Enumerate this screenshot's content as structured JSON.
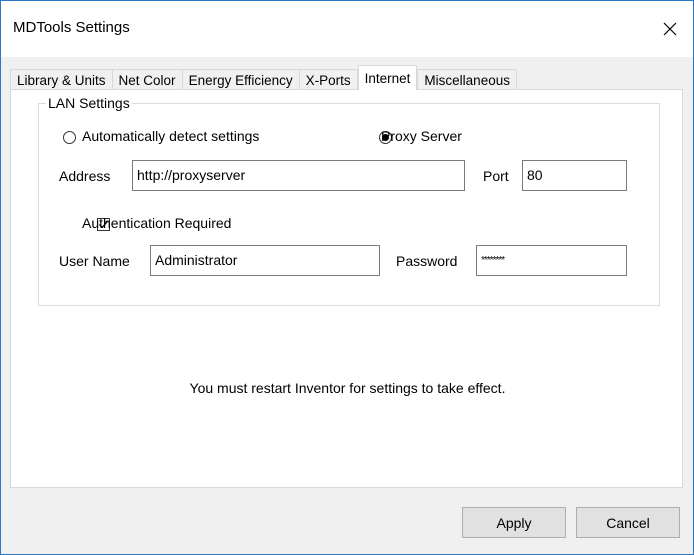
{
  "window": {
    "title": "MDTools Settings",
    "close_icon": "close-icon"
  },
  "tabs": [
    {
      "label": "Library & Units",
      "active": false
    },
    {
      "label": "Net Color",
      "active": false
    },
    {
      "label": "Energy Efficiency",
      "active": false
    },
    {
      "label": "X-Ports",
      "active": false
    },
    {
      "label": "Internet",
      "active": true
    },
    {
      "label": "Miscellaneous",
      "active": false
    }
  ],
  "lan": {
    "group_label": "LAN Settings",
    "auto_detect_label": "Automatically detect settings",
    "auto_detect_selected": false,
    "proxy_label": "Proxy Server",
    "proxy_selected": true,
    "address_label": "Address",
    "address_value": "http://proxyserver",
    "port_label": "Port",
    "port_value": "80",
    "auth_label": "Authentication Required",
    "auth_checked": true,
    "username_label": "User Name",
    "username_value": "Administrator",
    "password_label": "Password",
    "password_value": "********"
  },
  "notice": "You must restart Inventor for settings to take effect.",
  "buttons": {
    "apply": "Apply",
    "cancel": "Cancel"
  },
  "colors": {
    "window_border": "#2b79c6",
    "dialog_bg": "#f0f0f0",
    "panel_bg": "#ffffff"
  }
}
